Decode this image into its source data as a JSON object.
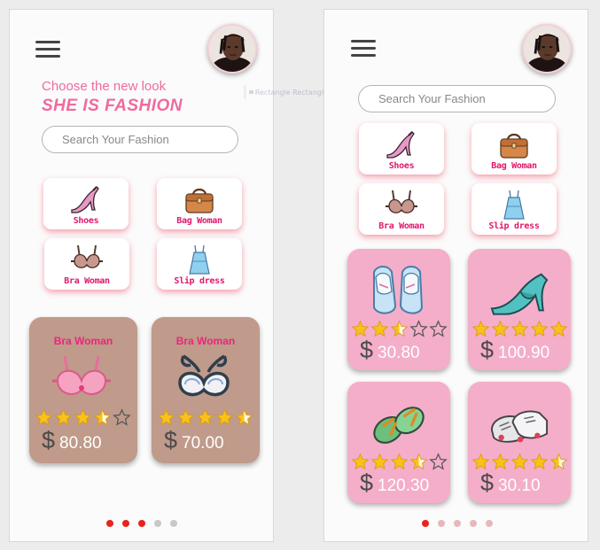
{
  "left_screen": {
    "tagline": "Choose the new look",
    "headline": "SHE IS FASHION",
    "search_placeholder": "Search Your Fashion",
    "categories": [
      {
        "label": "Shoes",
        "icon": "high-heel-icon"
      },
      {
        "label": "Bag Woman",
        "icon": "handbag-icon"
      },
      {
        "label": "Bra Woman",
        "icon": "bra-icon"
      },
      {
        "label": "Slip dress",
        "icon": "slip-dress-icon"
      }
    ],
    "products": [
      {
        "title": "Bra Woman",
        "rating": 3.5,
        "currency": "$",
        "price": "80.80",
        "icon": "pink-bra-icon"
      },
      {
        "title": "Bra Woman",
        "rating": 4.5,
        "currency": "$",
        "price": "70.00",
        "icon": "ribbon-bra-icon"
      }
    ],
    "pager": {
      "count": 5,
      "active": [
        0,
        1,
        2
      ]
    }
  },
  "ghost_layer": {
    "label": "Rectangle Rectangle"
  },
  "right_screen": {
    "search_placeholder": "Search Your Fashion",
    "categories": [
      {
        "label": "Shoes",
        "icon": "high-heel-icon"
      },
      {
        "label": "Bag Woman",
        "icon": "handbag-icon"
      },
      {
        "label": "Bra Woman",
        "icon": "bra-icon"
      },
      {
        "label": "Slip dress",
        "icon": "slip-dress-icon"
      }
    ],
    "products": [
      {
        "rating": 2.5,
        "currency": "$",
        "price": "30.80",
        "icon": "ballet-flats-icon"
      },
      {
        "rating": 5,
        "currency": "$",
        "price": "100.90",
        "icon": "teal-pump-icon"
      },
      {
        "rating": 3.5,
        "currency": "$",
        "price": "120.30",
        "icon": "flip-flops-icon"
      },
      {
        "rating": 4.5,
        "currency": "$",
        "price": "30.10",
        "icon": "sneakers-icon"
      }
    ],
    "pager": {
      "count": 5,
      "active": [
        0
      ]
    }
  },
  "colors": {
    "accent_pink": "#f06aa0",
    "label_pink": "#e0186a",
    "card_brown": "#c09a8a",
    "card_pink": "#f4aec9",
    "star_gold": "#f8c21a",
    "dot_active": "#e8231e",
    "dot_inactive_left": "#c8c8c8",
    "dot_inactive_right": "#e5b9bb"
  }
}
